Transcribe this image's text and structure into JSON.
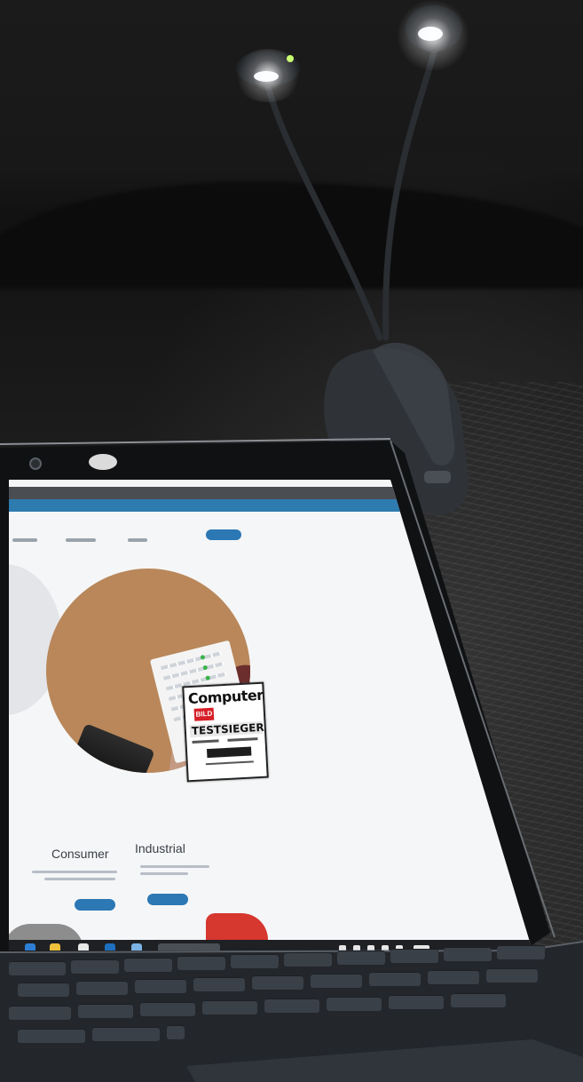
{
  "scene": {
    "description_free": true,
    "colors": {
      "room": "#161616",
      "lamp_body": "#2a2d31",
      "led": "#ffffff",
      "laptop_frame": "#101214",
      "screen_bg": "#f5f6f7",
      "brand_blue": "#2c78b5",
      "badge_red": "#d71f27",
      "keyboard": "#3a4048"
    }
  },
  "badge": {
    "brand": "Computer",
    "subbrand": "BILD",
    "headline": "TESTSIEGER"
  },
  "website": {
    "sections": [
      {
        "title": "Consumer"
      },
      {
        "title": "Industrial"
      }
    ]
  },
  "icons": {
    "camera": "webcam-icon",
    "lamp": "clip-lamp-icon"
  }
}
